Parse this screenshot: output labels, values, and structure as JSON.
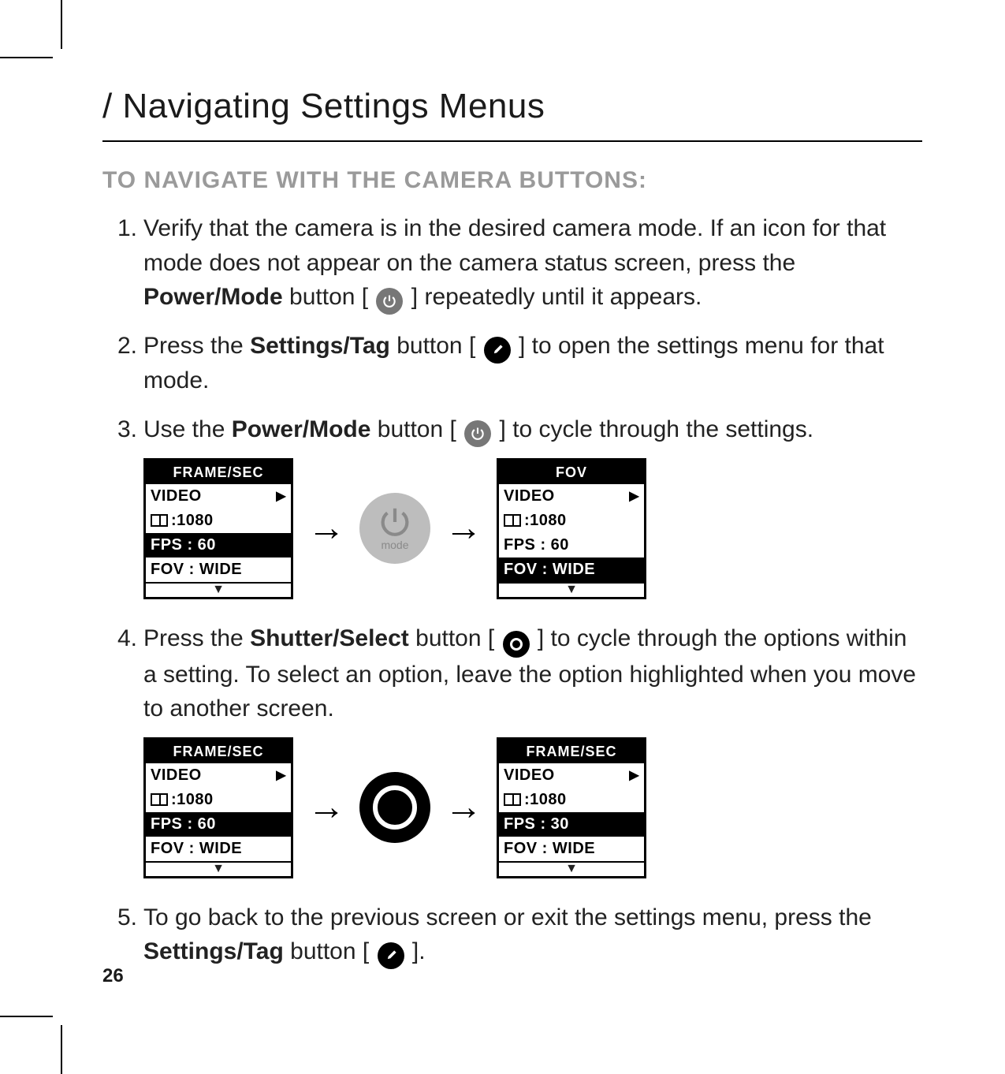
{
  "page": {
    "title": "/ Navigating Settings Menus",
    "subhead": "TO NAVIGATE WITH THE CAMERA BUTTONS:",
    "number": "26"
  },
  "steps": {
    "s1": {
      "num": "1.",
      "a": "Verify that the camera is in the desired camera mode. If an icon for that mode does not appear on the camera status screen, press the ",
      "b": "Power/Mode",
      "c": " button [ ",
      "d": " ] repeatedly until it appears."
    },
    "s2": {
      "num": "2.",
      "a": "Press the ",
      "b": "Settings/Tag",
      "c": " button [ ",
      "d": " ] to open the settings menu for that mode."
    },
    "s3": {
      "num": "3.",
      "a": "Use the ",
      "b": "Power/Mode",
      "c": " button [ ",
      "d": " ] to cycle through the settings."
    },
    "s4": {
      "num": "4.",
      "a": "Press the ",
      "b": "Shutter/Select",
      "c": " button [ ",
      "d": " ] to cycle through the options within a setting. To select an option, leave the option highlighted when you move to another screen."
    },
    "s5": {
      "num": "5.",
      "a": "To go back to the previous screen or exit the settings menu, press the ",
      "b": "Settings/Tag",
      "c": " button [ ",
      "d": " ]."
    }
  },
  "lcd": {
    "frame_sec": "FRAME/SEC",
    "fov": "FOV",
    "video": "VIDEO",
    "res1080": ":1080",
    "fps60": "FPS : 60",
    "fps30": "FPS : 30",
    "fovwide": "FOV : WIDE",
    "down": "▼",
    "tri": "▶",
    "mode_label": "mode"
  }
}
